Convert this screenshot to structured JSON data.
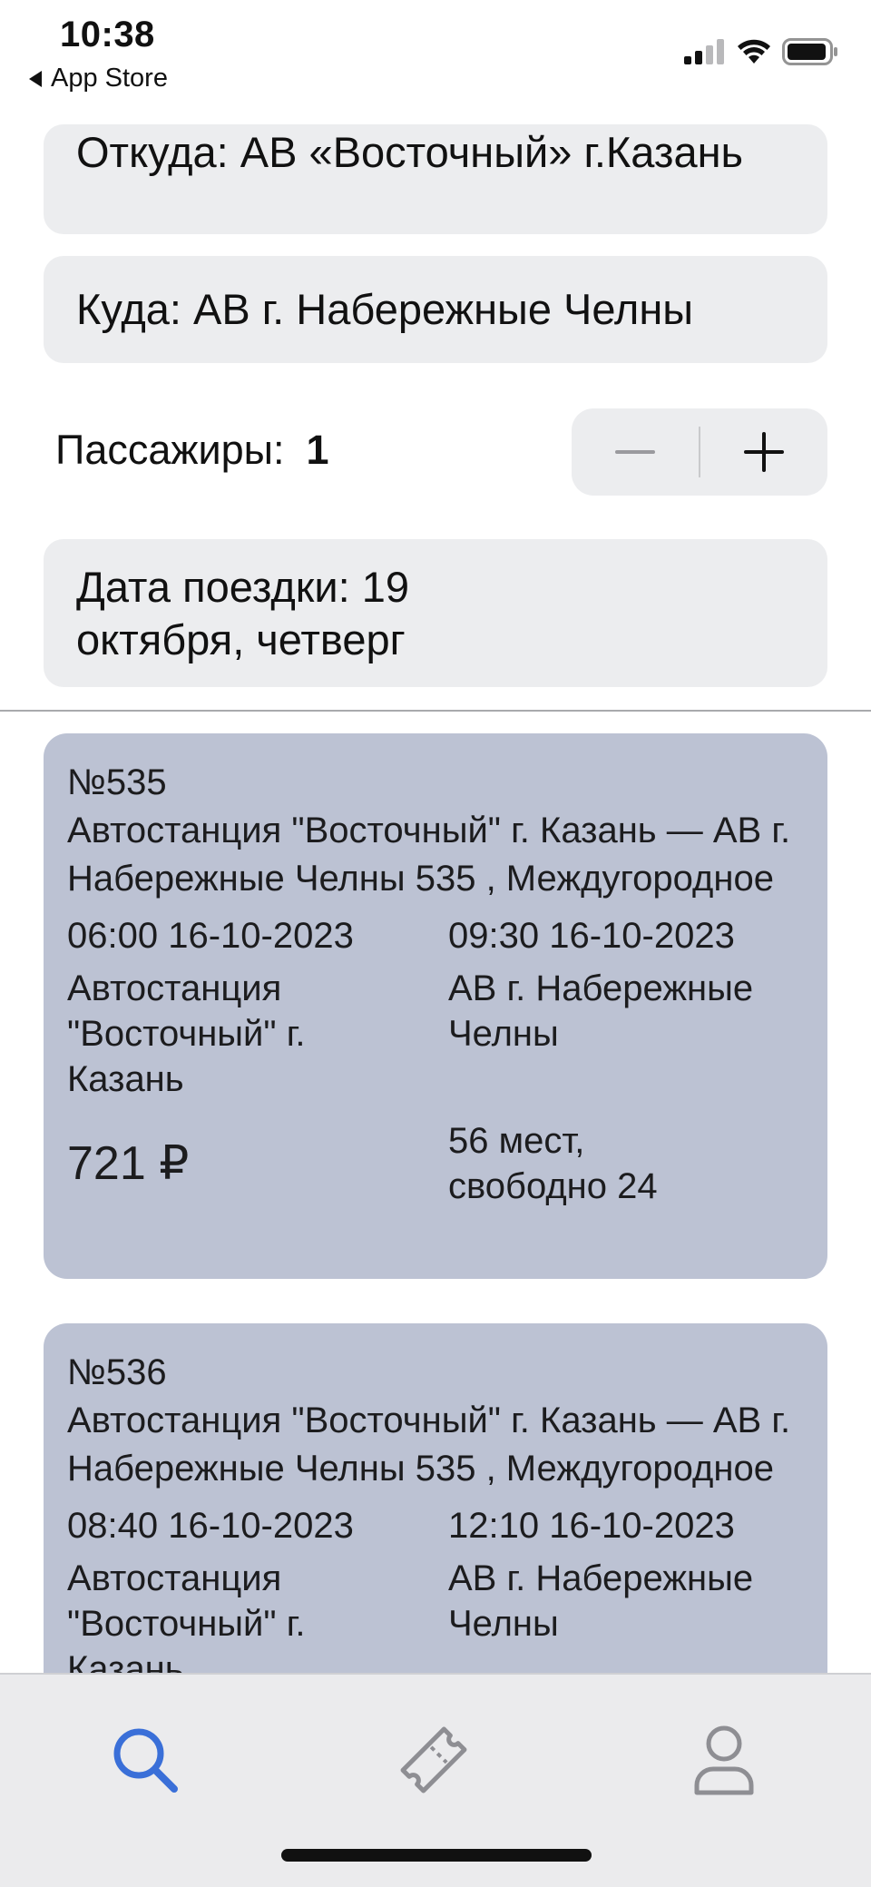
{
  "status_bar": {
    "time": "10:38",
    "back_label": "App Store"
  },
  "search": {
    "from": "Откуда: АВ «Восточный» г.Казань",
    "to": "Куда: АВ г. Набережные Челны",
    "passengers_label": "Пассажиры:",
    "passengers_count": "1",
    "date": "Дата поездки: 19 октября, четверг"
  },
  "trips": [
    {
      "number": "№535",
      "route": "Автостанция \"Восточный\" г. Казань — АВ г. Набережные Челны 535 , Междугородное",
      "departure": "06:00 16-10-2023",
      "arrival": "09:30 16-10-2023",
      "from_station": "Автостанция \"Восточный\" г. Казань",
      "to_station": "АВ г. Набережные Челны",
      "price": "721 ₽",
      "seats": "56 мест, свободно 24"
    },
    {
      "number": "№536",
      "route": "Автостанция \"Восточный\" г. Казань — АВ г. Набережные Челны 535 , Междугородное",
      "departure": "08:40 16-10-2023",
      "arrival": "12:10 16-10-2023",
      "from_station": "Автостанция \"Восточный\" г. Казань",
      "to_station": "АВ г. Набережные Челны",
      "price": "",
      "seats": ""
    }
  ],
  "tab_bar": {
    "active_tab": "search",
    "icons": [
      "search-icon",
      "ticket-icon",
      "person-icon"
    ],
    "active_color": "#3a6fd8",
    "inactive_color": "#8e8e93"
  },
  "colors": {
    "card_background": "#bcc2d3",
    "field_background": "#ecedef"
  }
}
